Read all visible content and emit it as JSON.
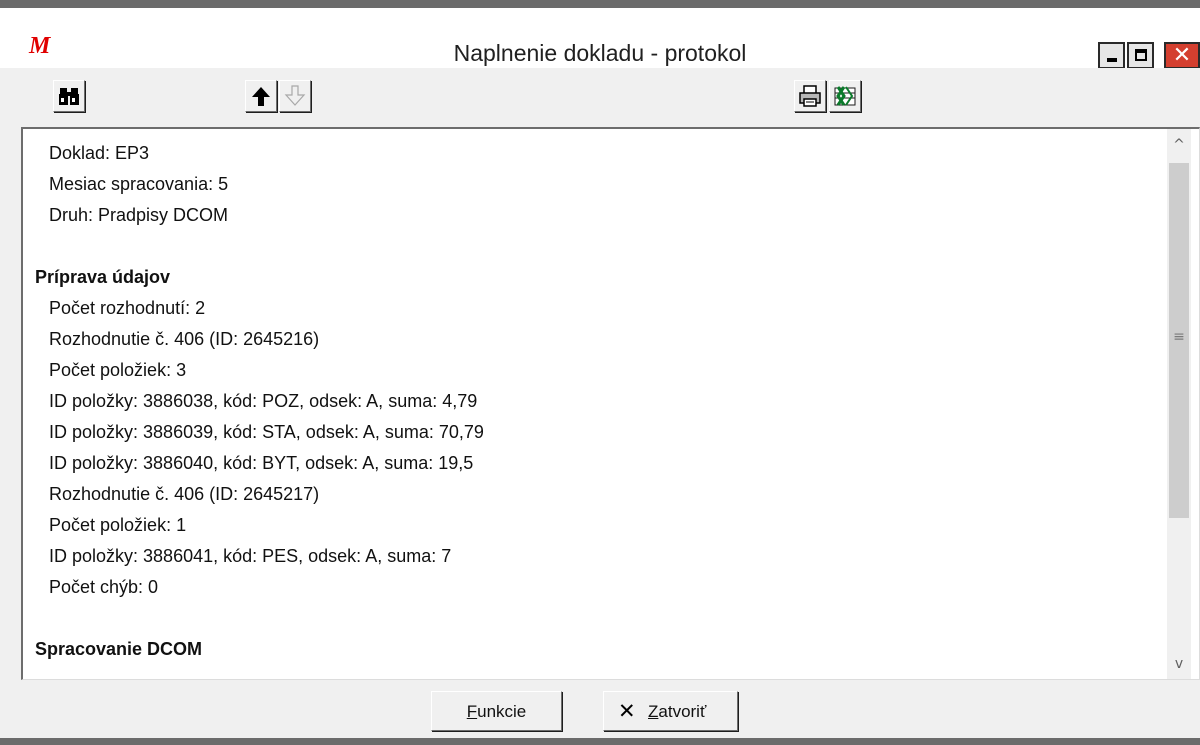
{
  "window": {
    "logo": "M",
    "title": "Naplnenie dokladu - protokol"
  },
  "icons": {
    "minimize": "minimize-icon",
    "maximize": "maximize-icon",
    "close": "close-icon",
    "find": "binoculars-icon",
    "prev": "arrow-up-icon",
    "next": "arrow-down-icon",
    "print": "printer-icon",
    "export": "excel-icon"
  },
  "colors": {
    "logo": "#e00000",
    "close_button": "#d43f2f",
    "scroll_thumb": "#cdcdcd"
  },
  "window_controls": {
    "close_glyph": "✕"
  },
  "log": {
    "lines": [
      "Doklad: EP3",
      "Mesiac spracovania: 5",
      "Druh: Pradpisy DCOM",
      "Príprava údajov",
      "Počet rozhodnutí: 2",
      "Rozhodnutie č. 406 (ID: 2645216)",
      "Počet položiek: 3",
      "ID položky: 3886038, kód: POZ, odsek: A, suma: 4,79",
      "ID položky: 3886039, kód: STA, odsek: A, suma: 70,79",
      "ID položky: 3886040, kód: BYT, odsek: A, suma: 19,5",
      "Rozhodnutie č. 406 (ID: 2645217)",
      "Počet položiek: 1",
      "ID položky: 3886041, kód: PES, odsek: A, suma: 7",
      "Počet chýb: 0",
      "Spracovanie DCOM"
    ]
  },
  "scrollbar": {
    "up_arrow": "^",
    "down_arrow": "v",
    "grip": "≡"
  },
  "footer": {
    "funkcie_first": "F",
    "funkcie_rest": "unkcie",
    "zatvorit_icon": "✕",
    "zatvorit_first": "Z",
    "zatvorit_rest": "atvoriť"
  }
}
